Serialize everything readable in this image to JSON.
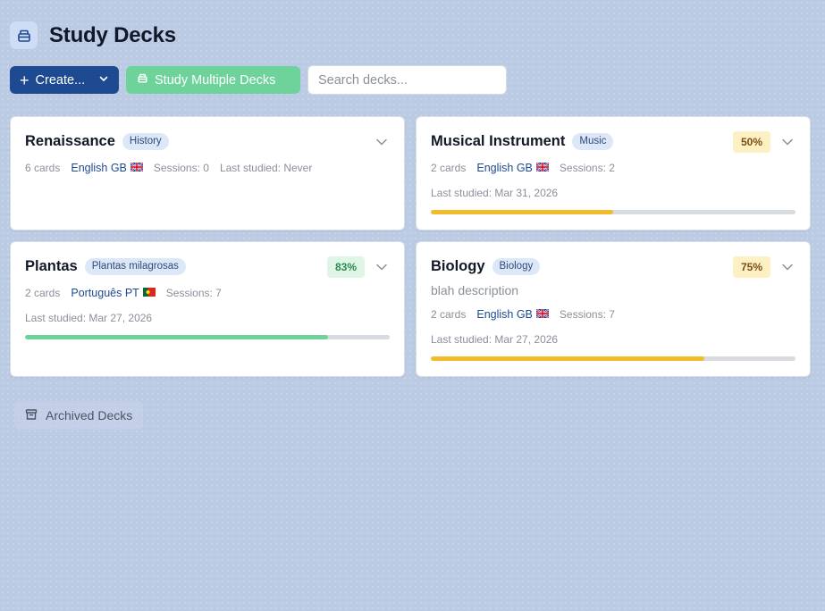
{
  "header": {
    "title": "Study Decks",
    "icon": "box-icon"
  },
  "toolbar": {
    "create_label": "Create...",
    "study_multiple_label": "Study Multiple Decks",
    "search_placeholder": "Search decks..."
  },
  "decks": [
    {
      "title": "Renaissance",
      "tag": "History",
      "cards": "6 cards",
      "language": "English GB",
      "flag": "uk",
      "sessions": "Sessions: 0",
      "last_studied": "Last studied: Never",
      "description": "",
      "progress_percent": null
    },
    {
      "title": "Musical Instrument",
      "tag": "Music",
      "cards": "2 cards",
      "language": "English GB",
      "flag": "uk",
      "sessions": "Sessions: 2",
      "last_studied": "Last studied: Mar 31, 2026",
      "description": "",
      "progress_label": "50%",
      "progress_percent": 50,
      "progress_color": "#f2bb2c"
    },
    {
      "title": "Plantas",
      "tag": "Plantas milagrosas",
      "cards": "2 cards",
      "language": "Português PT",
      "flag": "pt",
      "sessions": "Sessions: 7",
      "last_studied": "Last studied: Mar 27, 2026",
      "description": "",
      "progress_label": "83%",
      "progress_percent": 83,
      "progress_color": "#6ed39a"
    },
    {
      "title": "Biology",
      "tag": "Biology",
      "cards": "2 cards",
      "language": "English GB",
      "flag": "uk",
      "sessions": "Sessions: 7",
      "last_studied": "Last studied: Mar 27, 2026",
      "description": "blah description",
      "progress_label": "75%",
      "progress_percent": 75,
      "progress_color": "#f2bb2c"
    }
  ],
  "archived": {
    "label": "Archived Decks",
    "icon": "archive-icon"
  },
  "colors": {
    "primary": "#1e4a91",
    "success": "#6ed39a",
    "warning": "#f2bb2c"
  }
}
